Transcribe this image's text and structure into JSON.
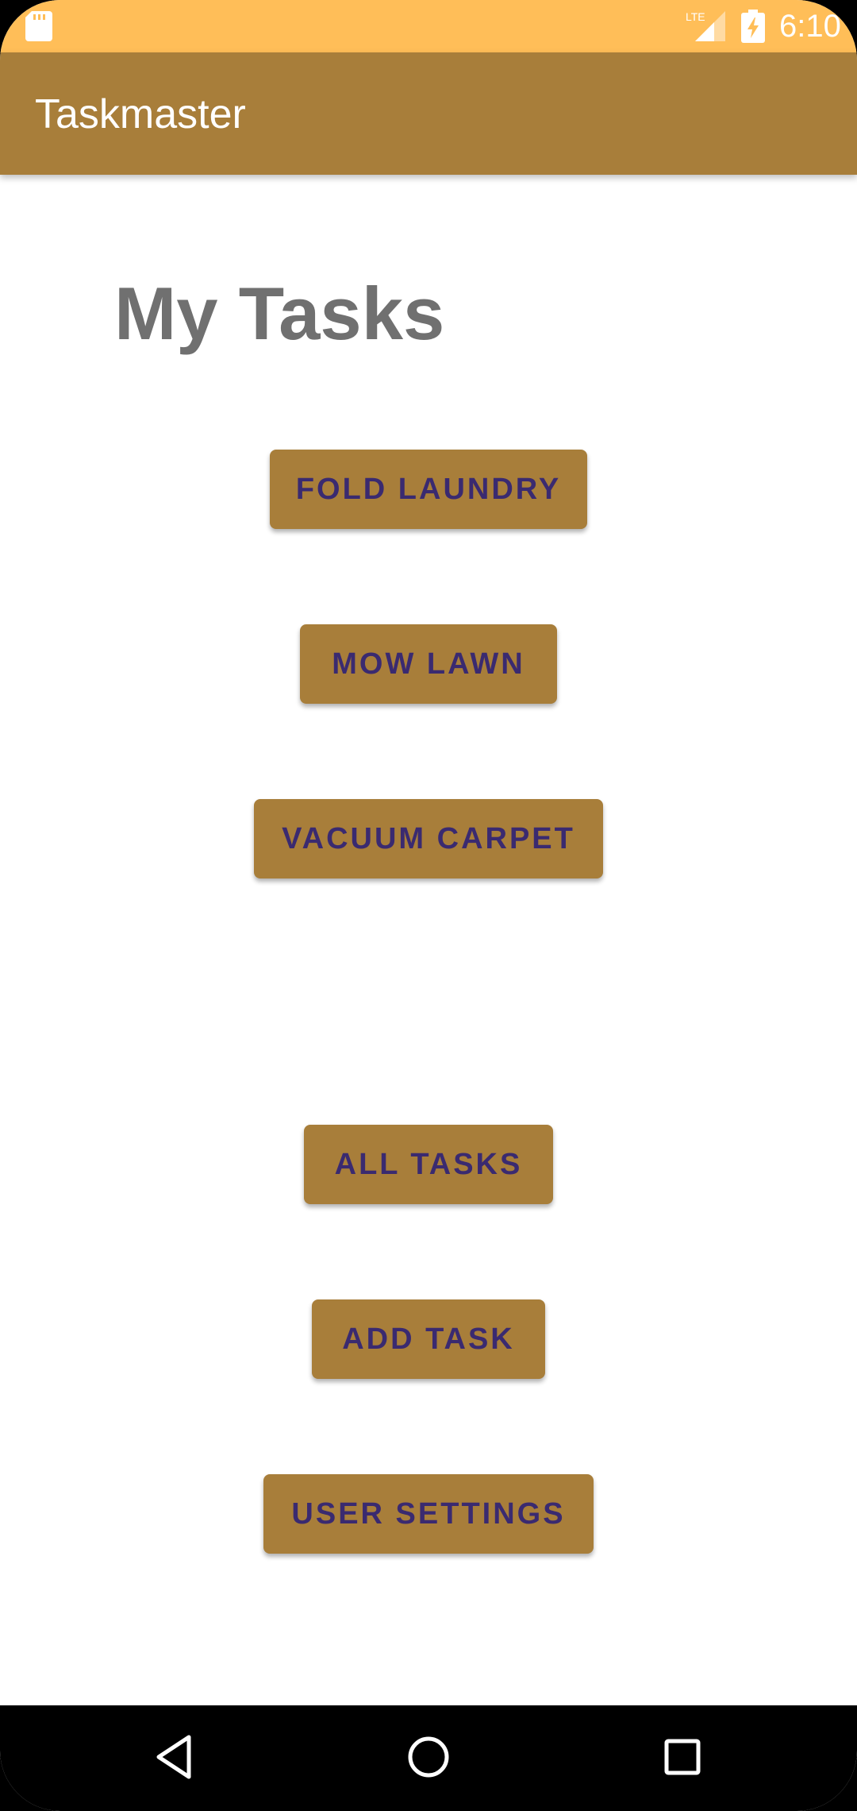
{
  "status_bar": {
    "time": "6:10",
    "network_label": "LTE",
    "background_color": "#FFBE58",
    "icons": [
      "sd-card-icon",
      "signal-icon",
      "battery-charging-icon"
    ]
  },
  "app_bar": {
    "title": "Taskmaster",
    "background_color": "#A87E3A"
  },
  "main": {
    "heading": "My Tasks",
    "task_buttons": [
      {
        "label": "FOLD LAUNDRY"
      },
      {
        "label": "MOW LAWN"
      },
      {
        "label": "VACUUM CARPET"
      }
    ],
    "action_buttons": [
      {
        "label": "ALL TASKS"
      },
      {
        "label": "ADD TASK"
      },
      {
        "label": "USER SETTINGS"
      }
    ],
    "button_color": "#A87E3A",
    "button_text_color": "#3A2A70"
  },
  "nav_bar": {
    "icons": [
      "back-icon",
      "home-icon",
      "recents-icon"
    ]
  }
}
